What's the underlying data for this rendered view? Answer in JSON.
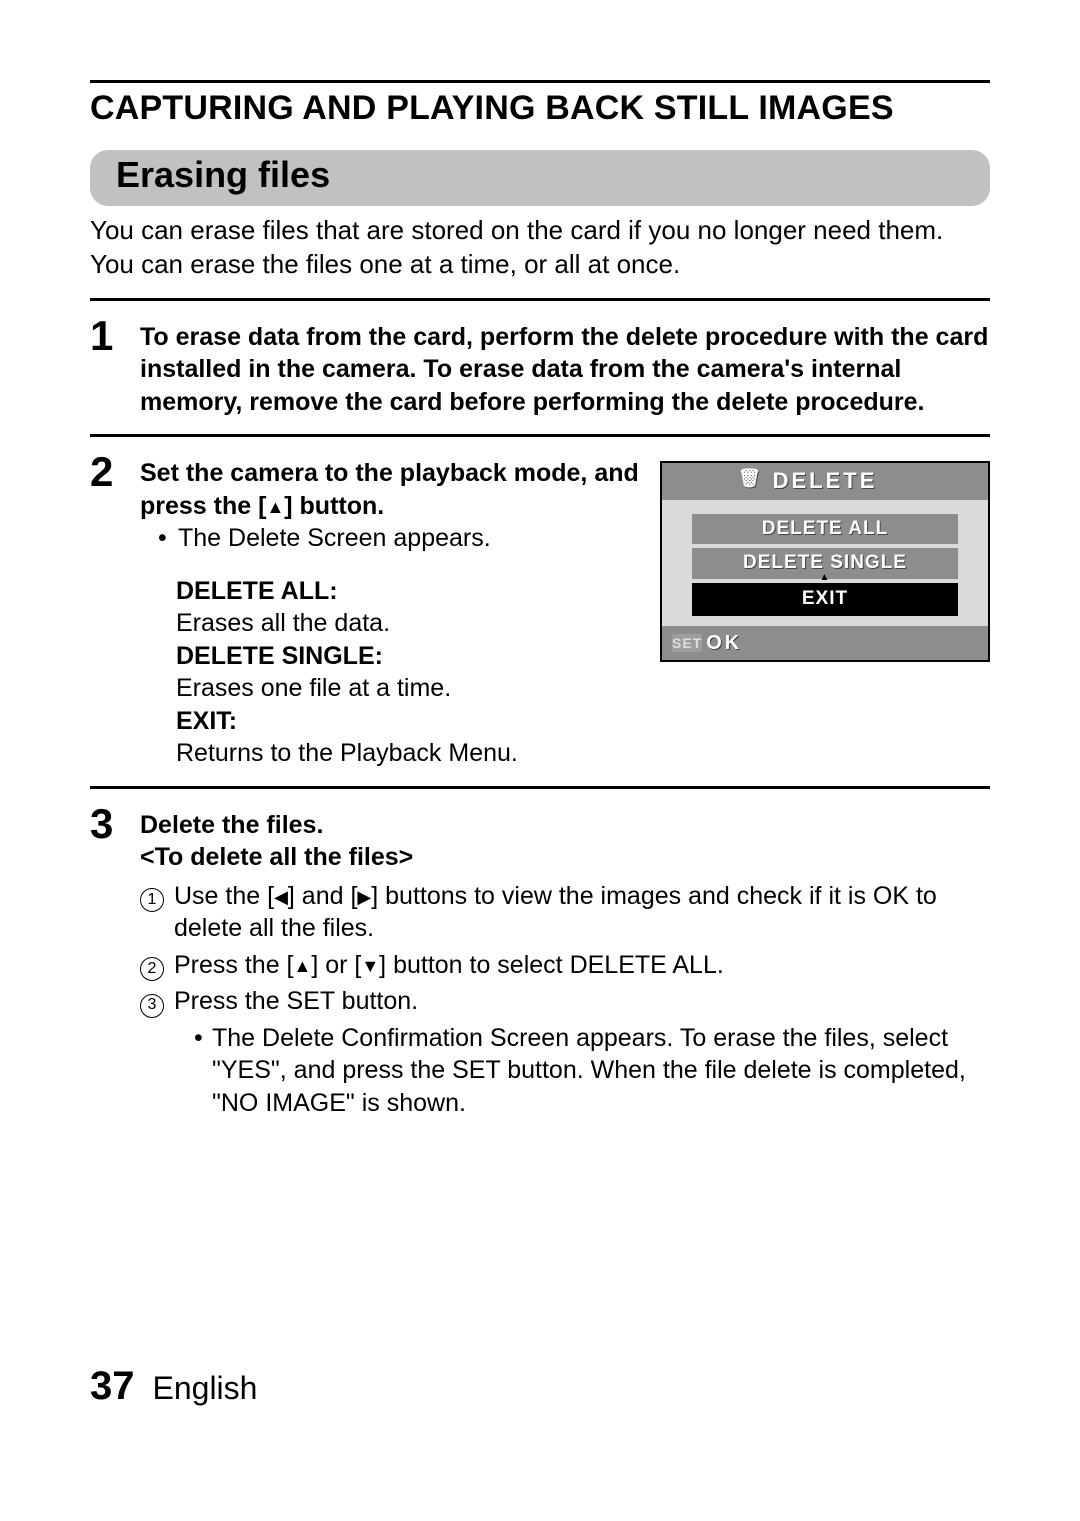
{
  "pageTitle": "CAPTURING AND PLAYING BACK STILL IMAGES",
  "sectionHeading": "Erasing files",
  "intro1": "You can erase files that are stored on the card if you no longer need them.",
  "intro2": "You can erase the files one at a time, or all at once.",
  "step1": {
    "num": "1",
    "text": "To erase data from the card, perform the delete procedure with the card installed in the camera. To erase data from the camera's internal memory, remove the card before performing the delete procedure."
  },
  "step2": {
    "num": "2",
    "lead_a": "Set the camera to the playback mode, and press the [",
    "lead_b": "] button.",
    "bullet": "The Delete Screen appears.",
    "defs": {
      "da_t": "DELETE ALL:",
      "da_b": "Erases all the data.",
      "ds_t": "DELETE SINGLE:",
      "ds_b": "Erases one file at a time.",
      "ex_t": "EXIT:",
      "ex_b": "Returns to the Playback Menu."
    }
  },
  "lcd": {
    "title": "DELETE",
    "opt1": "DELETE ALL",
    "opt2": "DELETE SINGLE",
    "opt3": "EXIT",
    "set": "SET",
    "ok": "OK"
  },
  "step3": {
    "num": "3",
    "h1": "Delete the files.",
    "h2": "<To delete all the files>",
    "r1a": "Use the [",
    "r1b": "] and [",
    "r1c": "] buttons to view the images and check if it is OK to delete all the files.",
    "r2a": "Press the [",
    "r2b": "] or [",
    "r2c": "] button to select DELETE ALL.",
    "r3": "Press the SET button.",
    "r3sub": "The Delete Confirmation Screen appears. To erase the files, select \"YES\", and press the SET button. When the file delete is completed, \"NO IMAGE\" is shown."
  },
  "footer": {
    "page": "37",
    "lang": "English"
  },
  "glyph": {
    "up": "▲",
    "down": "▼",
    "left": "◀",
    "right": "▶",
    "trash": "🗑"
  }
}
